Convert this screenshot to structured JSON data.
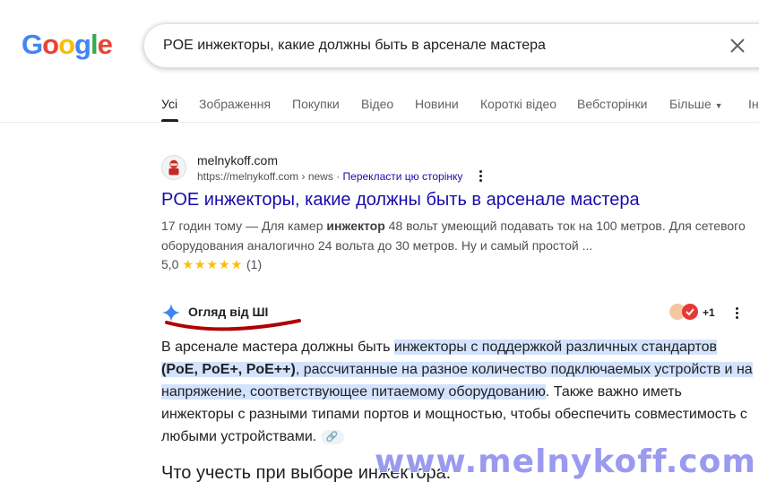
{
  "logo": {
    "letters": [
      "G",
      "o",
      "o",
      "g",
      "l",
      "e"
    ],
    "colors": [
      "#4285F4",
      "#EA4335",
      "#FBBC05",
      "#4285F4",
      "#34A853",
      "#EA4335"
    ]
  },
  "search": {
    "query": "POE инжекторы, какие должны быть в арсенале мастера",
    "clear_icon": "close-icon"
  },
  "tabs": [
    "Усі",
    "Зображення",
    "Покупки",
    "Відео",
    "Новини",
    "Короткі відео",
    "Вебсторінки",
    "Більше",
    "Ін"
  ],
  "result": {
    "site_name": "melnykoff.com",
    "url": "https://melnykoff.com › news",
    "translate": "Перекласти цю сторінку",
    "title": "POE инжекторы, какие должны быть в арсенале мастера",
    "snippet": {
      "time": "17 годин тому",
      "sep": " — ",
      "t1": "Для камер ",
      "bold": "инжектор",
      "t2": " 48 вольт умеющий подавать ток на 100 метров. Для сетевого оборудования аналогично 24 вольта до 30 метров. Ну и самый простой ..."
    },
    "rating": {
      "score": "5,0",
      "stars": "★★★★★",
      "count": "(1)"
    }
  },
  "ai_overview": {
    "title": "Огляд від ШІ",
    "more_sources": "+1",
    "p1": "В арсенале мастера должны быть ",
    "h1": "инжекторы с поддержкой различных стандартов ",
    "h1b": "(PoE, PoE+, PoE++)",
    "h1c": ", рассчитанные на разное количество подключаемых устройств и на напряжение, соответствующее питаемому оборудованию",
    "p2": ". Также важно иметь инжекторы с разными типами портов и мощностью, чтобы обеспечить совместимость с любыми устройствами.",
    "link_icon": "link-icon",
    "subheading": "Что учесть при выборе инжектора:"
  },
  "watermark": "www.melnykoff.com",
  "colors": {
    "link": "#1a0dab",
    "highlight": "#d3e3fd",
    "underline_marker": "#b00000"
  }
}
